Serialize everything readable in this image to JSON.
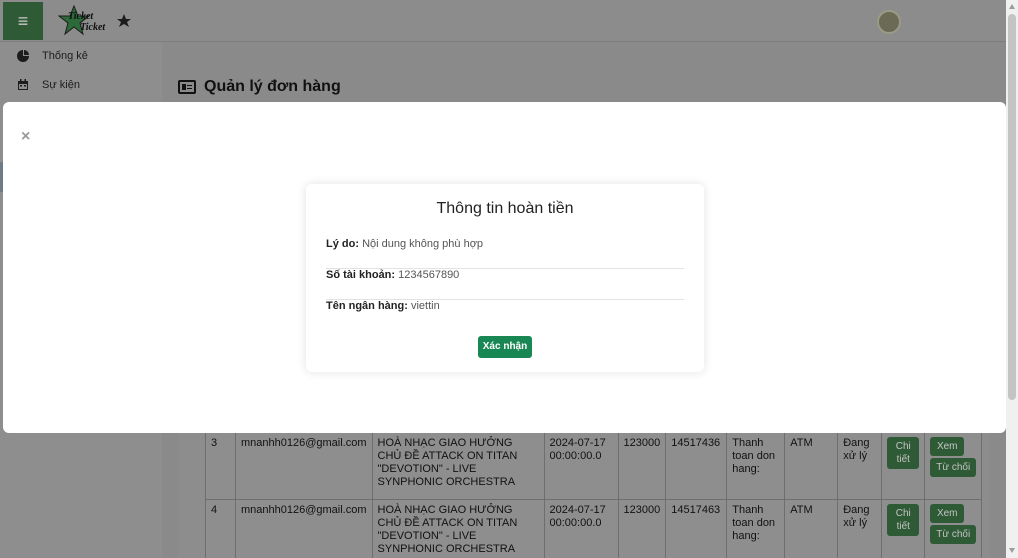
{
  "topbar": {
    "menu_icon": "hamburger-icon",
    "logo_text": "Ticket Ticket",
    "avatar": "user-avatar"
  },
  "sidebar": {
    "items": [
      {
        "label": "Thống kê",
        "icon": "pie-chart-icon"
      },
      {
        "label": "Sự kiện",
        "icon": "calendar-icon"
      }
    ]
  },
  "main": {
    "title": "Quản lý đơn hàng",
    "title_icon": "id-card-icon"
  },
  "orders": {
    "rows": [
      {
        "index": "3",
        "email": "mnanhh0126@gmail.com",
        "event": "HOÀ NHẠC GIAO HƯỞNG CHỦ ĐỀ ATTACK ON TITAN \"DEVOTION\" - LIVE SYNPHONIC ORCHESTRA",
        "date": "2024-07-17 00:00:00.0",
        "amount": "123000",
        "code": "14517436",
        "payment": "Thanh toan don hang:",
        "method": "ATM",
        "status": "Đang xử lý",
        "detail_label": "Chi tiết",
        "view_label": "Xem",
        "reject_label": "Từ chối"
      },
      {
        "index": "4",
        "email": "mnanhh0126@gmail.com",
        "event": "HOÀ NHẠC GIAO HƯỞNG CHỦ ĐỀ ATTACK ON TITAN \"DEVOTION\" - LIVE SYNPHONIC ORCHESTRA",
        "date": "2024-07-17 00:00:00.0",
        "amount": "123000",
        "code": "14517463",
        "payment": "Thanh toan don hang:",
        "method": "ATM",
        "status": "Đang xử lý",
        "detail_label": "Chi tiết",
        "view_label": "Xem",
        "reject_label": "Từ chối"
      }
    ]
  },
  "modal": {
    "close_symbol": "×",
    "title": "Thông tin hoàn tiền",
    "reason_label": "Lý do:",
    "reason_value": "Nội dung không phù hợp",
    "account_label": "Số tài khoản:",
    "account_value": "1234567890",
    "bank_label": "Tên ngân hàng:",
    "bank_value": "viettin",
    "confirm_label": "Xác nhận"
  },
  "colors": {
    "primary_green": "#198754",
    "dark_green": "#2f5a36",
    "overlay": "#8f8f8f"
  }
}
